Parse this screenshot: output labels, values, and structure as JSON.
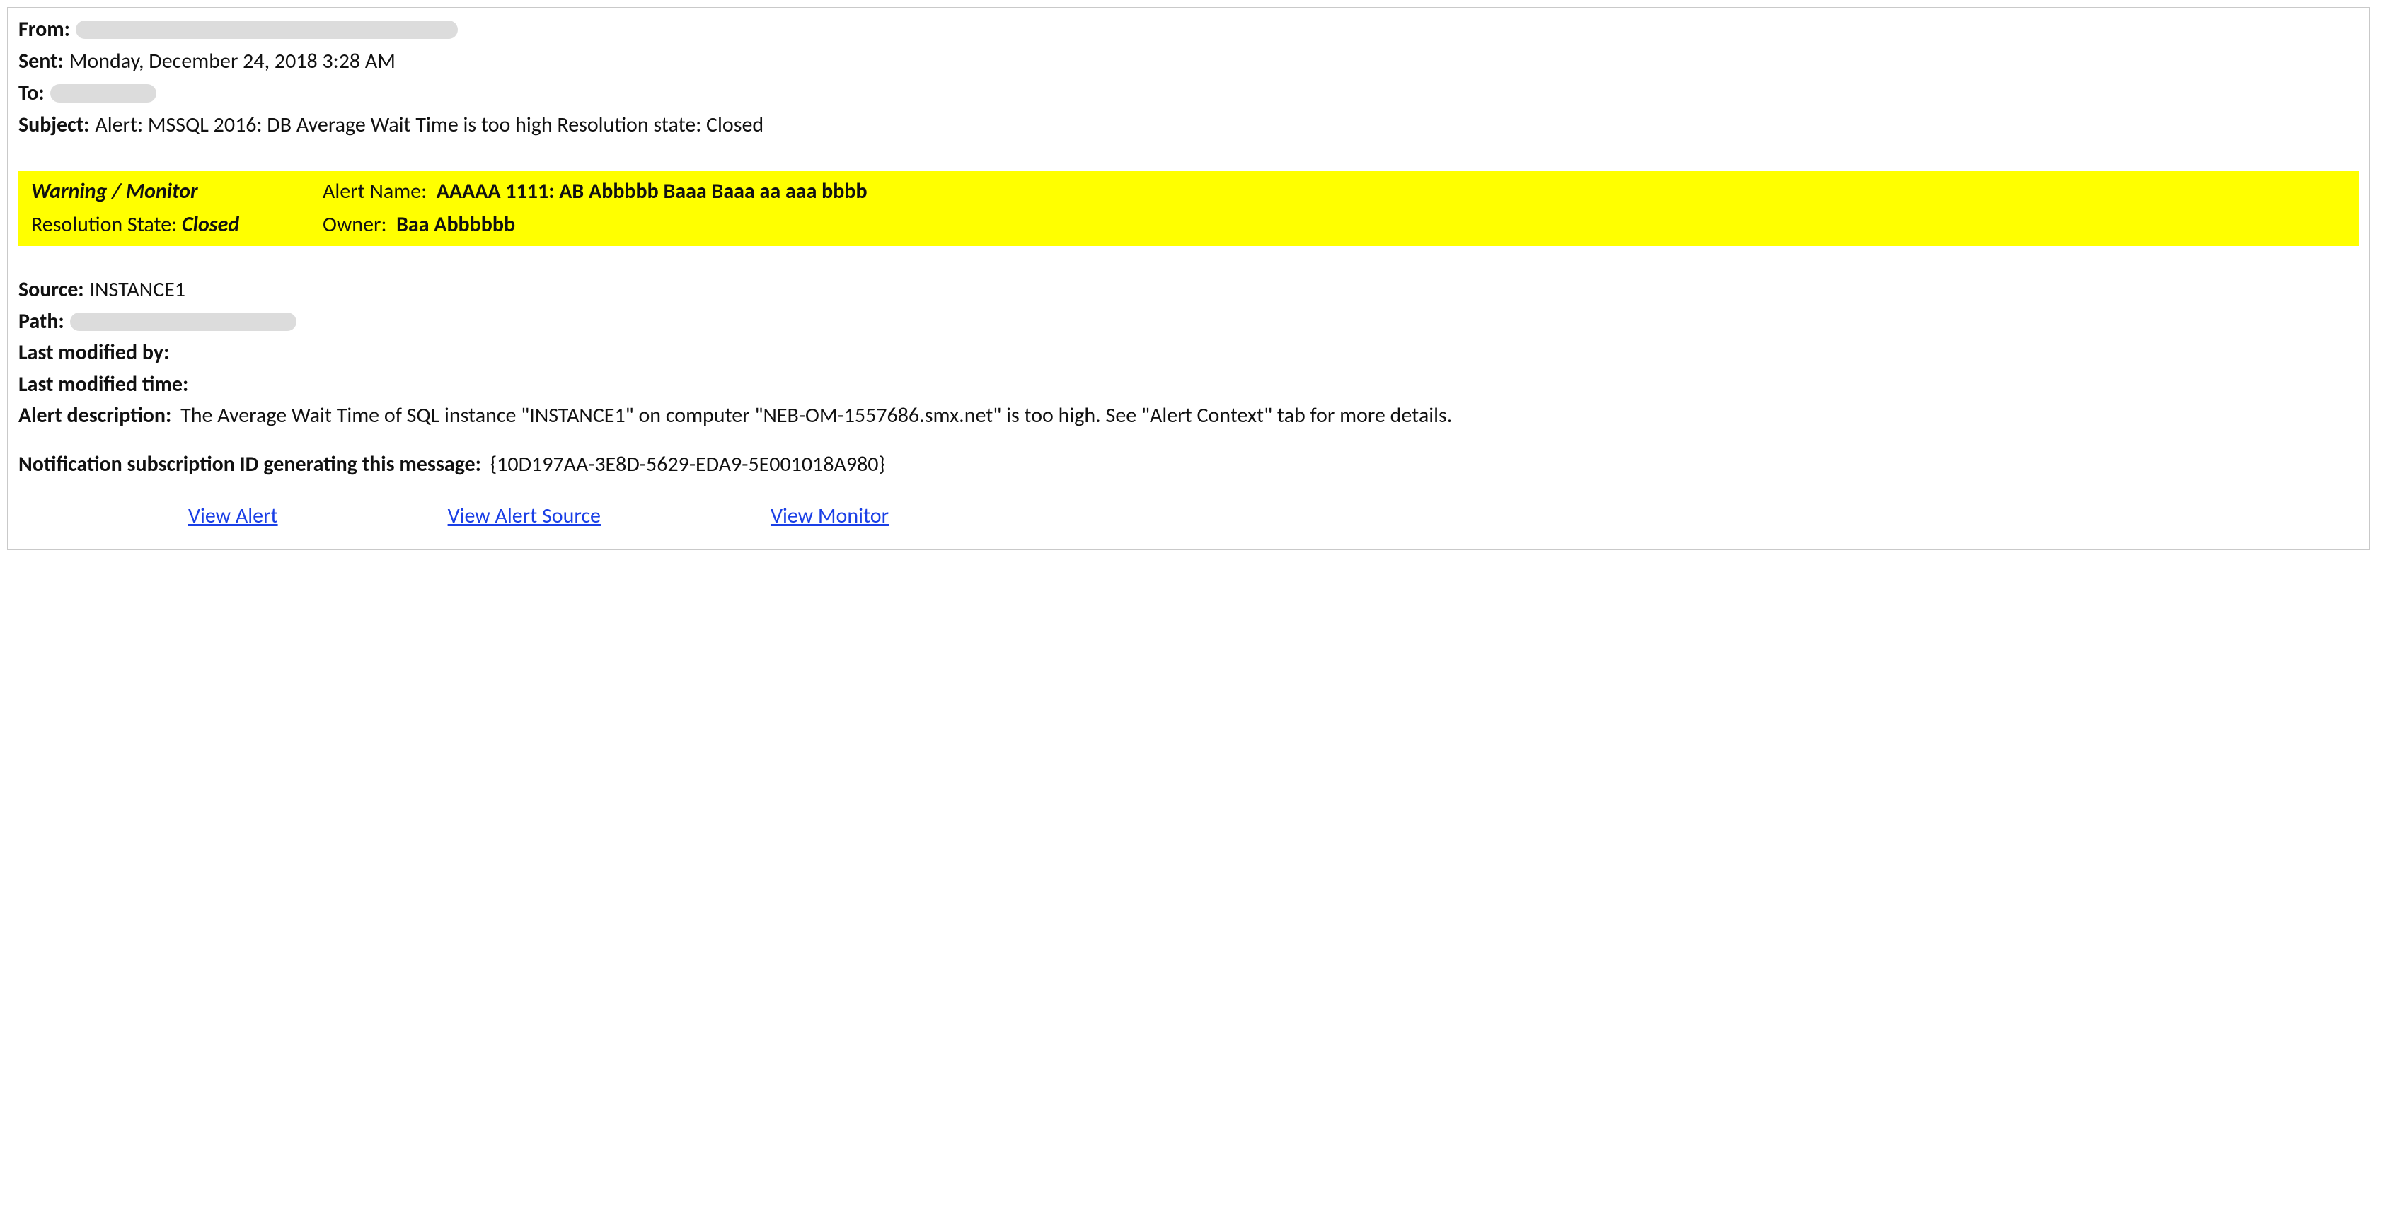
{
  "header": {
    "from_label": "From:",
    "from_value": "",
    "sent_label": "Sent:",
    "sent_value": "Monday, December 24, 2018 3:28 AM",
    "to_label": "To:",
    "to_value": "",
    "subject_label": "Subject:",
    "subject_value": "Alert: MSSQL 2016: DB Average Wait Time is too high Resolution state: Closed"
  },
  "band": {
    "warning_monitor": "Warning / Monitor",
    "resolution_state_label": "Resolution State:",
    "resolution_state_value": "Closed",
    "alert_name_label": "Alert Name:",
    "alert_name_value": "AAAAA 1111: AB Abbbbb Baaa Baaa aa aaa bbbb",
    "owner_label": "Owner:",
    "owner_value": "Baa Abbbbbb"
  },
  "details": {
    "source_label": "Source:",
    "source_value": "INSTANCE1",
    "path_label": "Path:",
    "path_value": "",
    "last_modified_by_label": "Last modified by:",
    "last_modified_by_value": "",
    "last_modified_time_label": "Last modified time:",
    "last_modified_time_value": "",
    "alert_description_label": "Alert description:",
    "alert_description_value": "The Average Wait Time of SQL instance \"INSTANCE1\" on computer \"NEB-OM-1557686.smx.net\" is too high. See \"Alert Context\" tab for more details.",
    "subscription_label": "Notification subscription ID generating this message:",
    "subscription_value": "{10D197AA-3E8D-5629-EDA9-5E001018A980}"
  },
  "links": {
    "view_alert": "View Alert",
    "view_alert_source": "View Alert Source",
    "view_monitor": "View Monitor"
  }
}
